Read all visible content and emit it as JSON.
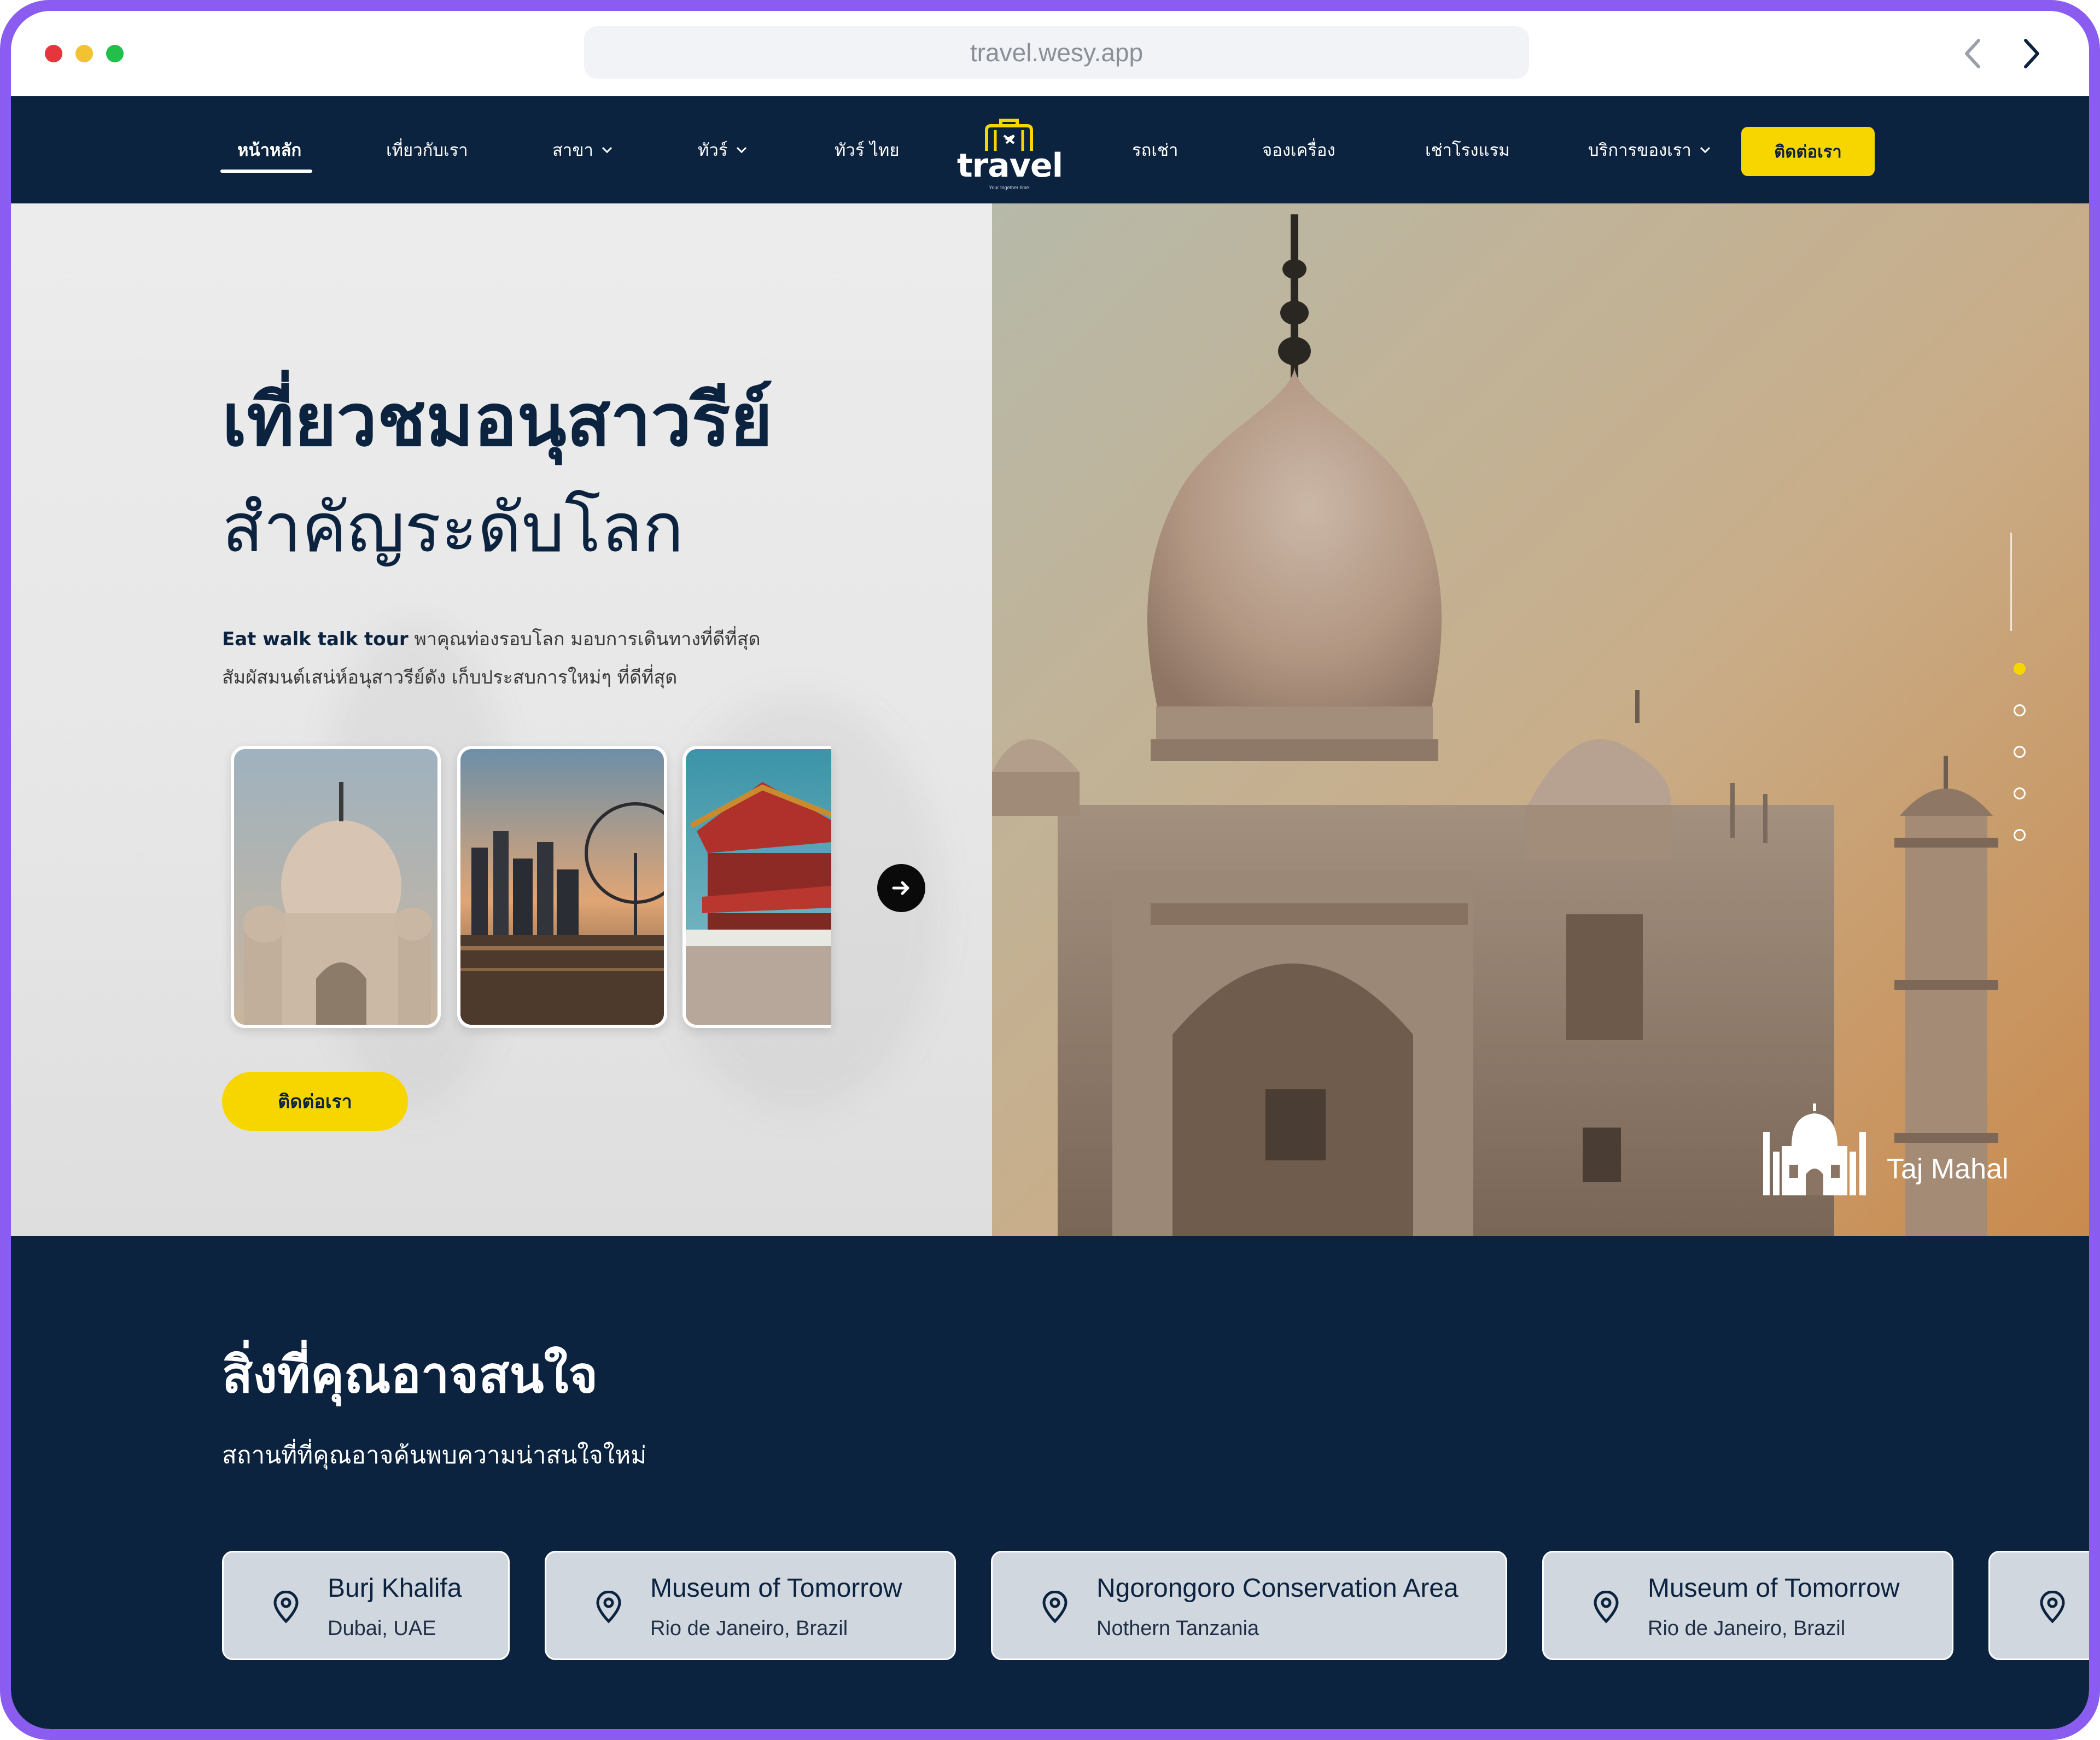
{
  "browser": {
    "url": "travel.wesy.app"
  },
  "nav": {
    "items": [
      {
        "label": "หน้าหลัก",
        "active": true,
        "dropdown": false
      },
      {
        "label": "เที่ยวกับเรา",
        "active": false,
        "dropdown": false
      },
      {
        "label": "สาขา",
        "active": false,
        "dropdown": true
      },
      {
        "label": "ทัวร์",
        "active": false,
        "dropdown": true
      },
      {
        "label": "ทัวร์ ไทย",
        "active": false,
        "dropdown": false
      },
      {
        "label": "รถเช่า",
        "active": false,
        "dropdown": false
      },
      {
        "label": "จองเครื่อง",
        "active": false,
        "dropdown": false
      },
      {
        "label": "เช่าโรงแรม",
        "active": false,
        "dropdown": false
      },
      {
        "label": "บริการของเรา",
        "active": false,
        "dropdown": true
      }
    ],
    "logo_text": "travel",
    "logo_tagline": "Your together time",
    "cta_label": "ติดต่อเรา"
  },
  "hero": {
    "title_line1": "เที่ยวชมอนุสาวรีย์",
    "title_line2": "สำคัญระดับโลก",
    "desc_brand": "Eat walk talk tour",
    "desc_text1": " พาคุณท่องรอบโลก มอบการเดินทางที่ดีที่สุด",
    "desc_text2": "สัมผัสมนต์เสน่ห์อนุสาวรีย์ดัง เก็บประสบการใหม่ๆ ที่ดีที่สุด",
    "cta_label": "ติดต่อเรา",
    "featured_place": "Taj Mahal",
    "slide_count": 5,
    "active_slide": 1
  },
  "interest": {
    "title": "สิ่งที่คุณอาจสนใจ",
    "subtitle": "สถานที่ที่คุณอาจค้นพบความน่าสนใจใหม่",
    "places": [
      {
        "name": "Burj Khalifa",
        "location": "Dubai, UAE"
      },
      {
        "name": "Museum of Tomorrow",
        "location": "Rio de Janeiro, Brazil"
      },
      {
        "name": "Ngorongoro Conservation Area",
        "location": "Nothern Tanzania"
      },
      {
        "name": "Museum of Tomorrow",
        "location": "Rio de Janeiro, Brazil"
      }
    ]
  },
  "colors": {
    "navy": "#0c2340",
    "accent_yellow": "#f7d600",
    "frame_purple": "#8a5cf0"
  },
  "icons": [
    "chevron-left-icon",
    "chevron-right-icon",
    "chevron-down-icon",
    "arrow-right-icon",
    "map-pin-icon",
    "taj-mahal-icon",
    "suitcase-plane-icon"
  ]
}
